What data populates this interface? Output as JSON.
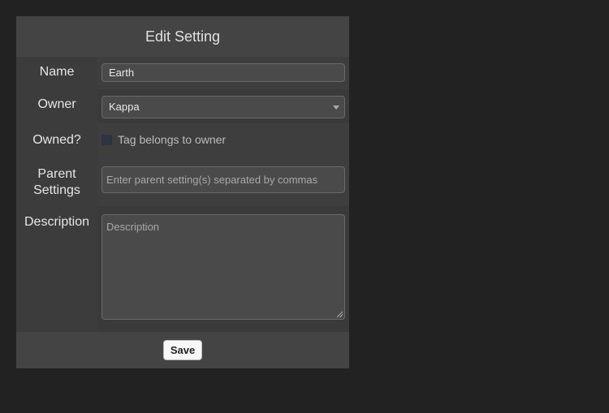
{
  "panel": {
    "title": "Edit Setting"
  },
  "form": {
    "name": {
      "label": "Name",
      "value": "Earth"
    },
    "owner": {
      "label": "Owner",
      "selected": "Kappa"
    },
    "owned": {
      "label": "Owned?",
      "checkbox_label": "Tag belongs to owner",
      "checked": false
    },
    "parent": {
      "label_line1": "Parent",
      "label_line2": "Settings",
      "placeholder": "Enter parent setting(s) separated by commas"
    },
    "description": {
      "label": "Description",
      "placeholder": "Description"
    }
  },
  "footer": {
    "save_label": "Save"
  },
  "icons": {
    "owner_dropdown": "chevron-down-icon",
    "description_resize": "resize-grip-icon"
  },
  "colors": {
    "background": "#222222",
    "panel": "#444444",
    "label_cell": "#3c3c3c",
    "input_bg": "#4a4a4a",
    "save_button": "#f7f7f7"
  }
}
